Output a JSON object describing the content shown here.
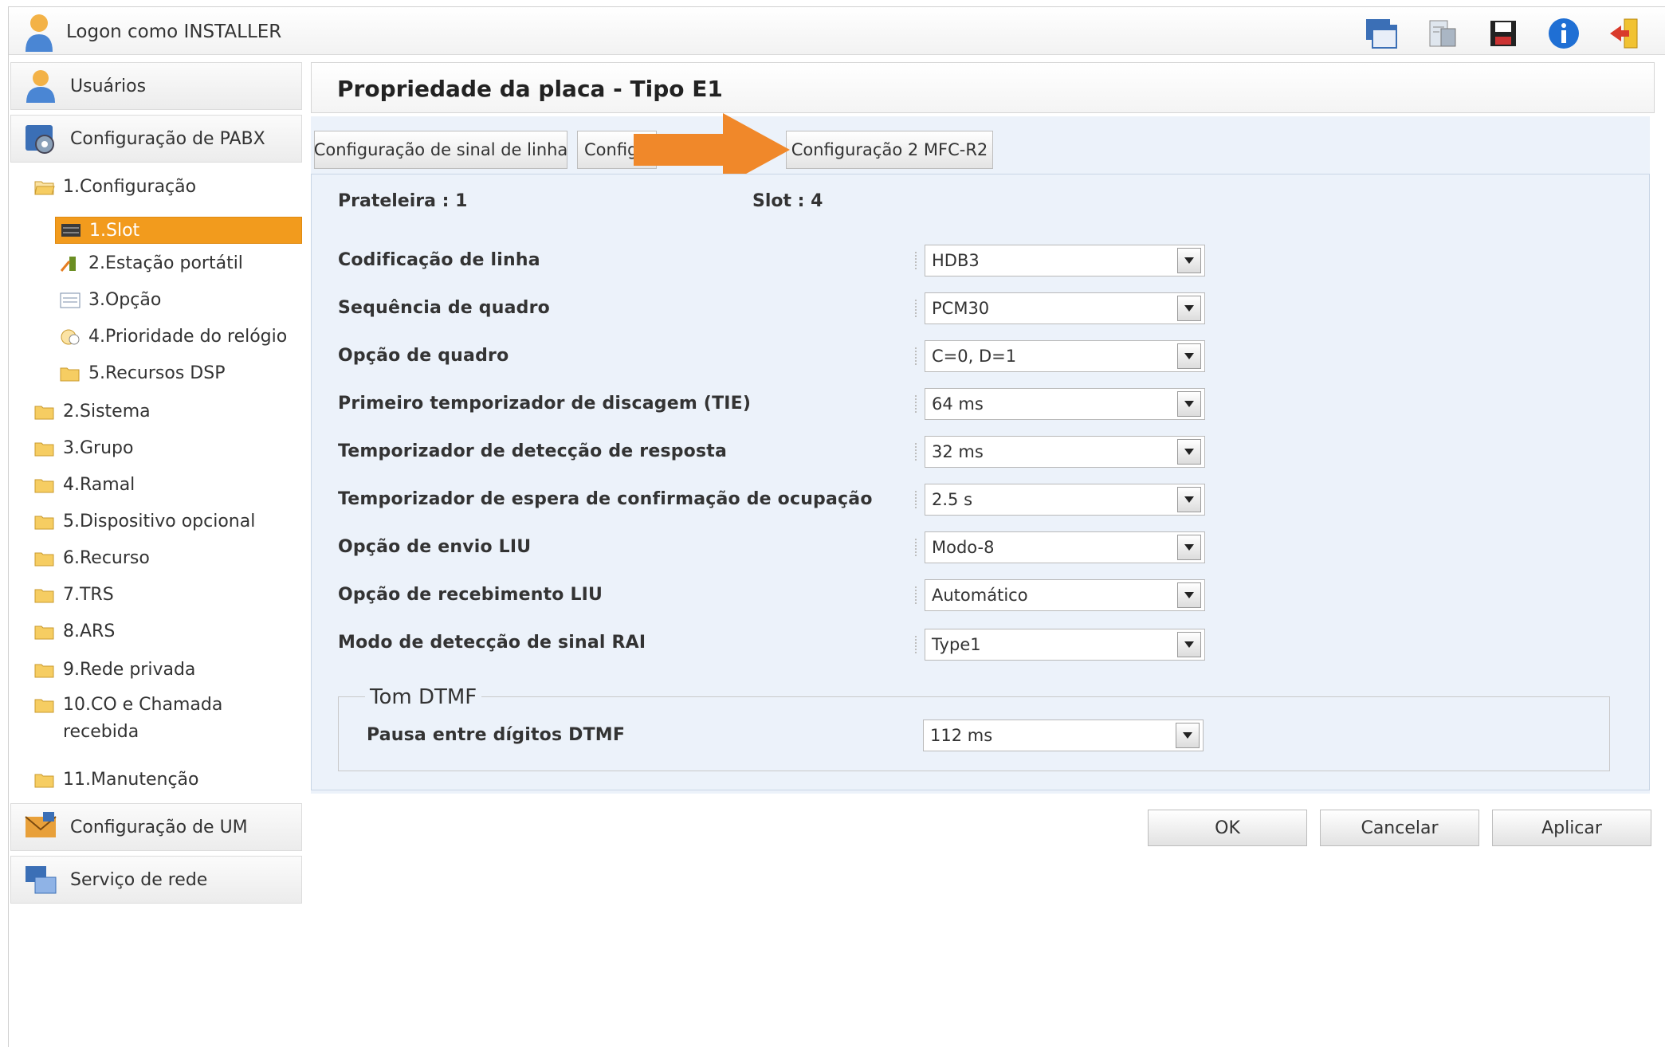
{
  "header": {
    "logon_text": "Logon como INSTALLER",
    "tools": [
      {
        "name": "window-icon"
      },
      {
        "name": "phone-directory-icon"
      },
      {
        "name": "save-icon"
      },
      {
        "name": "info-icon"
      },
      {
        "name": "logout-icon"
      }
    ]
  },
  "sidebar": {
    "users": "Usuários",
    "pabx": "Configuração de PABX",
    "tree": [
      "1.Configuração",
      "1.Slot",
      "2.Estação portátil",
      "3.Opção",
      "4.Prioridade do relógio",
      "5.Recursos DSP",
      "2.Sistema",
      "3.Grupo",
      "4.Ramal",
      "5.Dispositivo opcional",
      "6.Recurso",
      "7.TRS",
      "8.ARS",
      "9.Rede privada",
      "10.CO e Chamada",
      "recebida",
      "11.Manutenção"
    ],
    "um": "Configuração de UM",
    "network": "Serviço de rede"
  },
  "main": {
    "title": "Propriedade da placa - Tipo E1",
    "tabs": [
      "Configuração de sinal de linha",
      "Config",
      "Configuração 2 MFC-R2"
    ],
    "shelf_label": "Prateleira : 1",
    "slot_label": "Slot : 4",
    "fields": [
      {
        "label": "Codificação de linha",
        "value": "HDB3"
      },
      {
        "label": "Sequência de quadro",
        "value": "PCM30"
      },
      {
        "label": "Opção de quadro",
        "value": "C=0, D=1"
      },
      {
        "label": "Primeiro temporizador de discagem (TIE)",
        "value": "64 ms"
      },
      {
        "label": "Temporizador de detecção de resposta",
        "value": "32 ms"
      },
      {
        "label": "Temporizador de espera de confirmação de ocupação",
        "value": "2.5 s"
      },
      {
        "label": "Opção de envio LIU",
        "value": "Modo-8"
      },
      {
        "label": "Opção de recebimento LIU",
        "value": "Automático"
      },
      {
        "label": "Modo de detecção de sinal RAI",
        "value": "Type1"
      }
    ],
    "dtmf": {
      "legend": "Tom DTMF",
      "label": "Pausa entre dígitos DTMF",
      "value": "112 ms"
    },
    "buttons": {
      "ok": "OK",
      "cancel": "Cancelar",
      "apply": "Aplicar"
    },
    "highlight_color": "#f29b1d"
  }
}
